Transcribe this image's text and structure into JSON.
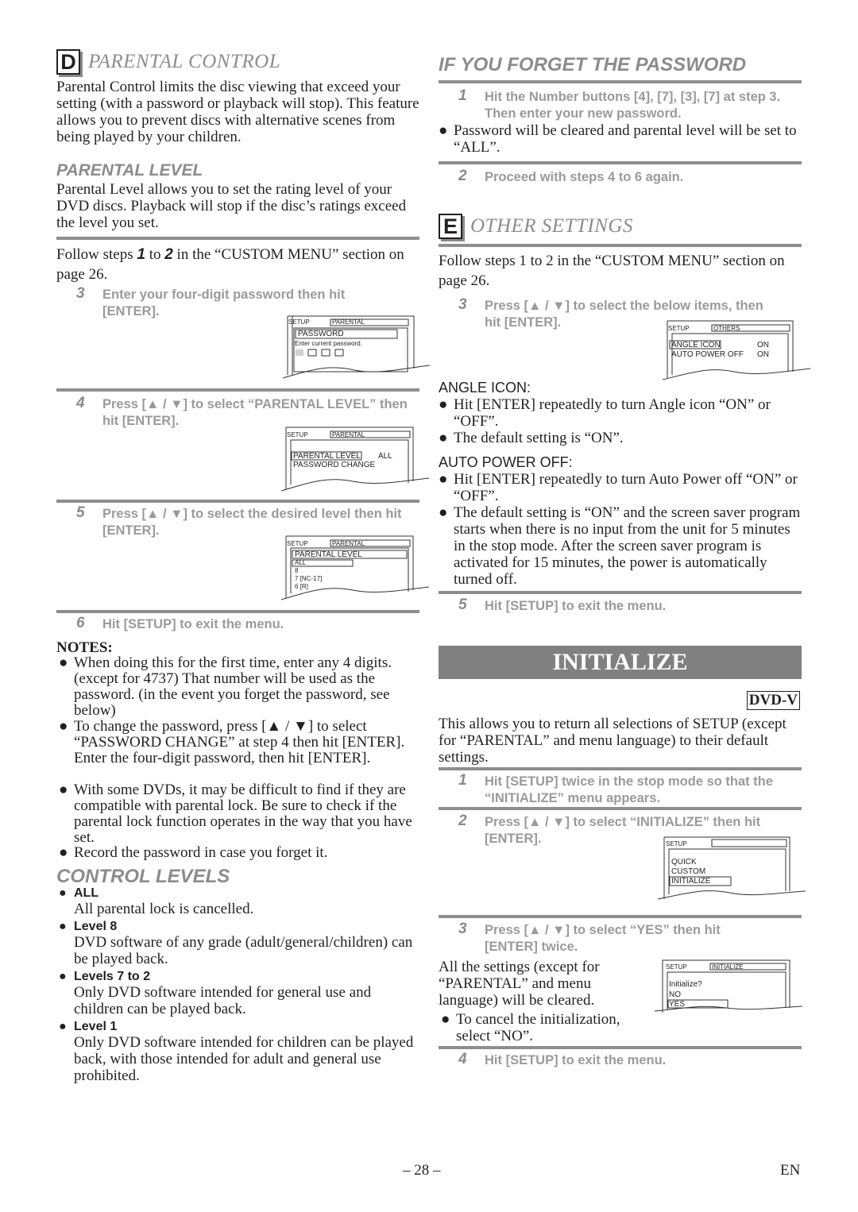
{
  "page": {
    "number": "– 28 –",
    "language": "EN"
  },
  "parental_control": {
    "letter": "D",
    "title": "PARENTAL CONTROL",
    "intro": "Parental Control limits the disc viewing that exceed your setting (with a password or playback will stop). This feature allows you to prevent discs with alternative scenes from being played by your children.",
    "level_heading": "PARENTAL LEVEL",
    "level_text": "Parental Level allows you to set the rating level of your DVD discs. Playback will stop if the disc’s ratings exceed the level you set.",
    "follow_prefix": "Follow steps ",
    "follow_from": "1",
    "follow_mid": " to ",
    "follow_to": "2",
    "follow_suffix": " in the “CUSTOM MENU” section on page 26.",
    "steps": [
      {
        "num": "3",
        "text": "Enter your four-digit password then hit [ENTER]."
      },
      {
        "num": "4",
        "text": "Press [▲ / ▼] to select “PARENTAL LEVEL” then hit [ENTER]."
      },
      {
        "num": "5",
        "text": "Press [▲ / ▼] to select the desired level then hit [ENTER]."
      },
      {
        "num": "6",
        "text": "Hit [SETUP] to exit the menu."
      }
    ],
    "screen_password": {
      "setup": "SETUP",
      "tab": "PARENTAL",
      "title": "PASSWORD",
      "prompt": "Enter current password."
    },
    "screen_menu": {
      "setup": "SETUP",
      "tab": "PARENTAL",
      "item1": "PARENTAL LEVEL",
      "item1_value": "ALL",
      "item2": "PASSWORD CHANGE"
    },
    "screen_levels": {
      "setup": "SETUP",
      "tab": "PARENTAL",
      "title": "PARENTAL LEVEL",
      "options": [
        "ALL",
        "8",
        "7 [NC-17]",
        "6 [R]"
      ]
    },
    "notes_heading": "NOTES:",
    "notes": [
      "When doing this for the first time, enter any 4 digits. (except for 4737) That number will be used as the password. (in the event you forget the password, see below)",
      "To change the password, press [▲ / ▼] to select “PASSWORD CHANGE” at step 4 then hit [ENTER]. Enter the four-digit password, then hit [ENTER].",
      "With some DVDs, it may be difficult to find if they are compatible with parental lock. Be sure to check if the parental lock function operates in the way that you have set.",
      "Record the password in case you forget it."
    ],
    "control_levels_heading": "CONTROL LEVELS",
    "control_levels": [
      {
        "name": "ALL",
        "desc": "All parental lock is cancelled."
      },
      {
        "name": "Level 8",
        "desc": "DVD software of any grade (adult/general/children) can be played back."
      },
      {
        "name": "Levels 7 to 2",
        "desc": "Only DVD software intended for general use and children can be played back."
      },
      {
        "name": "Level 1",
        "desc": "Only DVD software intended for children can be played back, with those intended for adult and general use prohibited."
      }
    ]
  },
  "forget_password": {
    "title": "IF YOU FORGET THE PASSWORD",
    "step1_num": "1",
    "step1_text": "Hit the Number buttons [4], [7], [3], [7] at step 3. Then enter your new password.",
    "bullet": "Password will be cleared and parental level will be set to “ALL”.",
    "step2_num": "2",
    "step2_text": "Proceed with steps 4 to 6 again."
  },
  "other_settings": {
    "letter": "E",
    "title": "OTHER SETTINGS",
    "follow": "Follow steps 1 to 2 in the “CUSTOM MENU” section on page 26.",
    "step3_num": "3",
    "step3_text": "Press [▲ / ▼] to select the below items, then hit [ENTER].",
    "screen": {
      "setup": "SETUP",
      "tab": "OTHERS",
      "item1": "ANGLE ICON",
      "item1_value": "ON",
      "item2": "AUTO POWER OFF",
      "item2_value": "ON"
    },
    "angle_heading": "ANGLE ICON:",
    "angle_bullets": [
      "Hit [ENTER] repeatedly to turn Angle icon “ON” or “OFF”.",
      "The default setting is “ON”."
    ],
    "auto_heading": "AUTO POWER OFF:",
    "auto_bullets": [
      "Hit [ENTER] repeatedly to turn Auto Power off “ON” or “OFF”.",
      "The default setting is “ON” and the screen saver program starts when there is no input from the unit for 5 minutes in the stop mode. After the screen saver program is activated for 15 minutes, the power is automatically turned off."
    ],
    "step5_num": "5",
    "step5_text": "Hit [SETUP] to exit the menu."
  },
  "initialize": {
    "title": "INITIALIZE",
    "badge": "DVD-V",
    "intro": "This allows you to return all selections of SETUP (except for “PARENTAL” and menu language) to their default settings.",
    "steps": [
      {
        "num": "1",
        "text": "Hit [SETUP] twice in the stop mode so that the “INITIALIZE” menu appears."
      },
      {
        "num": "2",
        "text": "Press [▲ / ▼] to select “INITIALIZE” then hit [ENTER]."
      },
      {
        "num": "3",
        "text": "Press [▲ / ▼] to select “YES” then hit [ENTER] twice."
      },
      {
        "num": "4",
        "text": "Hit [SETUP] to exit the menu."
      }
    ],
    "screen_menu": {
      "setup": "SETUP",
      "tab": "",
      "options": [
        "QUICK",
        "CUSTOM",
        "INITIALIZE"
      ]
    },
    "screen_confirm": {
      "setup": "SETUP",
      "tab": "INITIALIZE",
      "question": "Initialize?",
      "options": [
        "NO",
        "YES"
      ]
    },
    "cleared_text": "All the settings (except for “PARENTAL” and menu language) will be cleared.",
    "cancel_bullet": "To cancel the initialization, select “NO”."
  }
}
